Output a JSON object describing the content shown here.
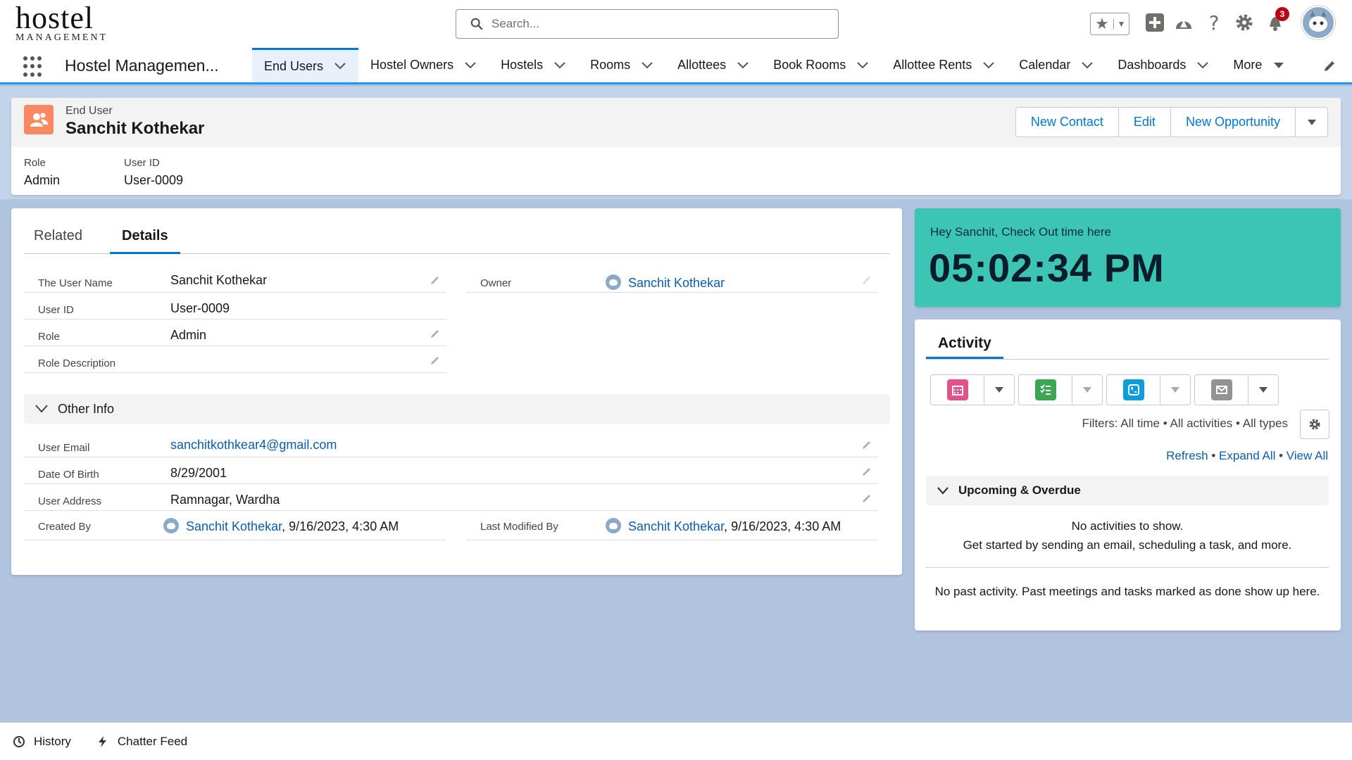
{
  "logo": {
    "line1": "hostel",
    "line2": "MANAGEMENT"
  },
  "search": {
    "placeholder": "Search..."
  },
  "notifications": {
    "count": "3"
  },
  "nav": {
    "app_name": "Hostel Managemen...",
    "items": [
      {
        "label": "End Users",
        "active": true
      },
      {
        "label": "Hostel Owners"
      },
      {
        "label": "Hostels"
      },
      {
        "label": "Rooms"
      },
      {
        "label": "Allottees"
      },
      {
        "label": "Book Rooms"
      },
      {
        "label": "Allottee Rents"
      },
      {
        "label": "Calendar"
      },
      {
        "label": "Dashboards"
      },
      {
        "label": "More"
      }
    ]
  },
  "record": {
    "type": "End User",
    "name": "Sanchit Kothekar",
    "actions": [
      "New Contact",
      "Edit",
      "New Opportunity"
    ],
    "highlights": [
      {
        "label": "Role",
        "value": "Admin"
      },
      {
        "label": "User ID",
        "value": "User-0009"
      }
    ]
  },
  "tabs": {
    "related": "Related",
    "details": "Details"
  },
  "fields": {
    "user_name": {
      "label": "The User Name",
      "value": "Sanchit Kothekar"
    },
    "owner": {
      "label": "Owner",
      "value": "Sanchit Kothekar"
    },
    "user_id": {
      "label": "User ID",
      "value": "User-0009"
    },
    "role": {
      "label": "Role",
      "value": "Admin"
    },
    "role_description": {
      "label": "Role Description",
      "value": ""
    },
    "section_other": "Other Info",
    "user_email": {
      "label": "User Email",
      "value": "sanchitkothkear4@gmail.com"
    },
    "dob": {
      "label": "Date Of Birth",
      "value": "8/29/2001"
    },
    "address": {
      "label": "User Address",
      "value": "Ramnagar, Wardha"
    },
    "created_by": {
      "label": "Created By",
      "user": "Sanchit Kothekar",
      "date": ", 9/16/2023, 4:30 AM"
    },
    "modified_by": {
      "label": "Last Modified By",
      "user": "Sanchit Kothekar",
      "date": ", 9/16/2023, 4:30 AM"
    }
  },
  "checkout": {
    "message": "Hey Sanchit, Check Out time here",
    "time": "05:02:34 PM",
    "color": "#3cc5b5"
  },
  "activity": {
    "title": "Activity",
    "filters": "Filters: All time • All activities • All types",
    "links": {
      "refresh": "Refresh",
      "expand": "Expand All",
      "view": "View All",
      "sep": " • "
    },
    "upcoming": "Upcoming & Overdue",
    "no_activities_1": "No activities to show.",
    "no_activities_2": "Get started by sending an email, scheduling a task, and more.",
    "past": "No past activity. Past meetings and tasks marked as done show up here.",
    "buttons": [
      {
        "icon": "calendar-icon",
        "color": "#e3518c"
      },
      {
        "icon": "task-icon",
        "color": "#3ba755"
      },
      {
        "icon": "call-icon",
        "color": "#0d9dda"
      },
      {
        "icon": "email-icon",
        "color": "#939393"
      }
    ]
  },
  "utility_bar": {
    "history": "History",
    "chatter": "Chatter Feed"
  },
  "colors": {
    "brand": "#0176d3",
    "link": "#0b5cab",
    "background": "#b0c4df"
  }
}
